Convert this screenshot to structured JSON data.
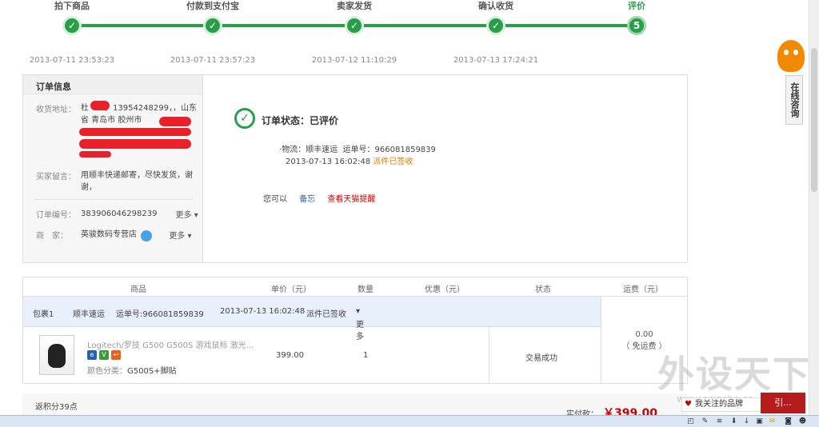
{
  "steps": [
    {
      "label": "拍下商品",
      "time": "2013-07-11 23:53:23",
      "mark": "✓"
    },
    {
      "label": "付款到支付宝",
      "time": "2013-07-11 23:57:23",
      "mark": "✓"
    },
    {
      "label": "卖家发货",
      "time": "2013-07-12 11:10:29",
      "mark": "✓"
    },
    {
      "label": "确认收货",
      "time": "2013-07-13 17:24:21",
      "mark": "✓"
    },
    {
      "label": "评价",
      "time": "",
      "mark": "5"
    }
  ],
  "order_info": {
    "title": "订单信息",
    "address_label": "收货地址：",
    "address_value": "杜　　，13954248299，，山东省 青岛市 胶州市",
    "message_label": "买家留言：",
    "message_value": "用顺丰快递邮寄，尽快发货，谢谢，",
    "order_no_label": "订单编号：",
    "order_no_value": "383906046298239",
    "seller_label": "商　家：",
    "seller_value": "英骏数码专营店",
    "more": "更多"
  },
  "status": {
    "icon": "check-circle-icon",
    "text": "订单状态：已评价",
    "logistics_label": "物流：",
    "carrier": "顺丰速运",
    "tracking_label": "运单号：",
    "tracking_no": "966081859839",
    "logistics_time": "2013-07-13 16:02:48",
    "logistics_status": "派件已签收",
    "you_can": "您可以",
    "action_memo": "备忘",
    "action_reminder": "查看天猫提醒"
  },
  "goods_table": {
    "headers": [
      "商品",
      "单价（元）",
      "数量",
      "优惠（元）",
      "状态",
      "运费（元）"
    ],
    "package": {
      "name": "包裹1",
      "carrier": "顺丰速运",
      "tracking": "运单号:966081859839",
      "time": "2013-07-13 16:02:48",
      "status": "派件已签收",
      "more": "更多"
    },
    "item": {
      "title": "Logitech/罗技 G500 G500S 游戏鼠标 激光...",
      "spec_label": "颜色分类：",
      "spec_value": "G500S+脚贴",
      "price": "399.00",
      "qty": "1",
      "status": "交易成功"
    },
    "shipping": {
      "fee": "0.00",
      "note": "（ 免运费 ）"
    }
  },
  "footer": {
    "points": "返积分39点",
    "paid_label": "实付款：",
    "paid_value": "￥399.00"
  },
  "side": {
    "consult": "在线咨询",
    "follow": "我关注的品牌",
    "box_label": "引..."
  },
  "watermark": {
    "big": "外设天下",
    "small": "www.ocinshe.cn"
  },
  "colors": {
    "accent": "#2a9d4a",
    "price": "#cc0000",
    "orange": "#e07a00"
  }
}
